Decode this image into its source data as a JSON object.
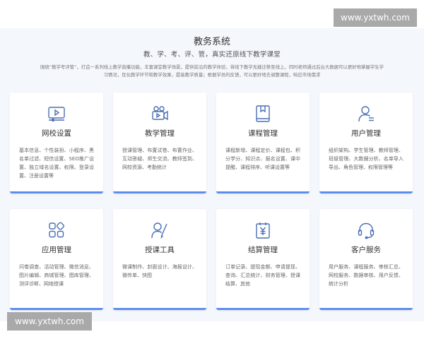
{
  "page": {
    "title": "教务系统",
    "subtitle": "教、学、考、评、管，真实还原线下教学课堂",
    "description": "围绕“教学考评管”，打造一系列线上教学直播功能，丰富课堂教学场景，提供前沿的教学体验，将线下教学无缝迁移至线上，同时老师通过后台大数据可以更好地掌握学生学习情况，优化教学环节和教学效果，提高教学质量；根据学员的反馈，可以更好地去调整课程，响应市场需求"
  },
  "accent_color": "#5b8def",
  "icon_color": "#4a6fb3",
  "cards": [
    {
      "icon": "video-player-icon",
      "name": "网校设置",
      "features": "基本信息、个性装扮、小程序、黑名单过滤、短信设置、SEO推广设置、独立域名设置、权限、登录设置、注册设置等"
    },
    {
      "icon": "video-camera-icon",
      "name": "教学管理",
      "features": "授课管理、布置试卷、布置作业、互动答疑、师生交流、教师签到、网校资源、考勤统计"
    },
    {
      "icon": "book-icon",
      "name": "课程管理",
      "features": "课程新增、课程定价、课程包、积分学分、知识点、报名设置、课中提醒、课程排序、听课设置等"
    },
    {
      "icon": "user-icon",
      "name": "用户管理",
      "features": "组织架构、学生管理、教师管理、班级管理、大数据分析、名单导入导出、角色管理、权限管理等"
    },
    {
      "icon": "apps-grid-icon",
      "name": "应用管理",
      "features": "问卷调查、活动管理、微信消息、图片编辑、商城管理、图库管理、测评诊断、网络授课"
    },
    {
      "icon": "teacher-icon",
      "name": "授课工具",
      "features": "微课制作、封面设计、海报设计、微传单、快图"
    },
    {
      "icon": "billing-icon",
      "name": "结算管理",
      "features": "订单记录、提现金额、申请提现、查询、汇总统计、财务管理、授课结算、其他"
    },
    {
      "icon": "headset-icon",
      "name": "客户服务",
      "features": "用户服务、课程服务、审核汇总、网校服务、数据审核、用户反馈、统计分析"
    }
  ],
  "watermark": "www.yxtwh.com"
}
